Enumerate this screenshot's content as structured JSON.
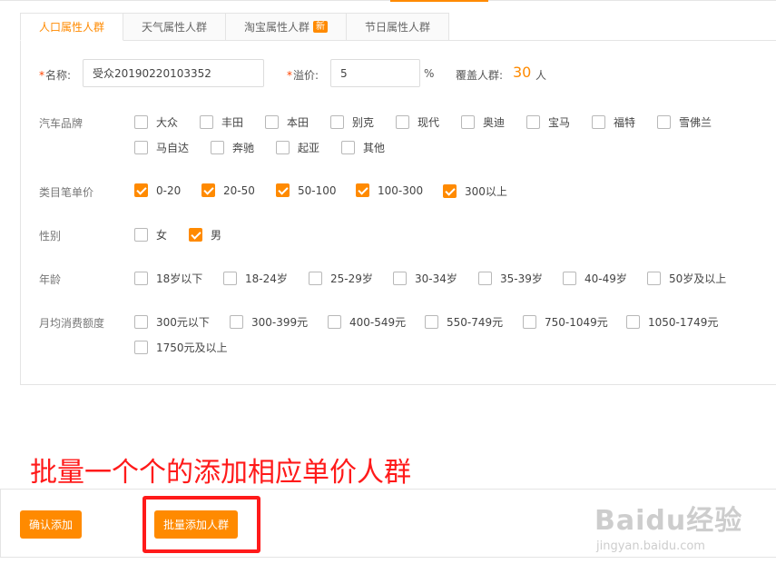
{
  "tabs": [
    {
      "label": "人口属性人群",
      "active": true
    },
    {
      "label": "天气属性人群",
      "active": false
    },
    {
      "label": "淘宝属性人群",
      "active": false,
      "badge": "新"
    },
    {
      "label": "节日属性人群",
      "active": false
    }
  ],
  "form": {
    "name_required": "*",
    "name_label": "名称:",
    "name_value": "受众20190220103352",
    "premium_required": "*",
    "premium_label": "溢价:",
    "premium_value": "5",
    "premium_unit": "%",
    "coverage_label": "覆盖人群:",
    "coverage_value": "30",
    "coverage_unit": "人"
  },
  "groups": {
    "car_brand": {
      "label": "汽车品牌",
      "options": [
        {
          "label": "大众",
          "checked": false
        },
        {
          "label": "丰田",
          "checked": false
        },
        {
          "label": "本田",
          "checked": false
        },
        {
          "label": "别克",
          "checked": false
        },
        {
          "label": "现代",
          "checked": false
        },
        {
          "label": "奥迪",
          "checked": false
        },
        {
          "label": "宝马",
          "checked": false
        },
        {
          "label": "福特",
          "checked": false
        },
        {
          "label": "雪佛兰",
          "checked": false
        },
        {
          "label": "马自达",
          "checked": false
        },
        {
          "label": "奔驰",
          "checked": false
        },
        {
          "label": "起亚",
          "checked": false
        },
        {
          "label": "其他",
          "checked": false
        }
      ]
    },
    "unit_price": {
      "label": "类目笔单价",
      "options": [
        {
          "label": "0-20",
          "checked": true
        },
        {
          "label": "20-50",
          "checked": true
        },
        {
          "label": "50-100",
          "checked": true
        },
        {
          "label": "100-300",
          "checked": true
        },
        {
          "label": "300以上",
          "checked": true
        }
      ]
    },
    "gender": {
      "label": "性别",
      "options": [
        {
          "label": "女",
          "checked": false
        },
        {
          "label": "男",
          "checked": true
        }
      ]
    },
    "age": {
      "label": "年龄",
      "options": [
        {
          "label": "18岁以下",
          "checked": false
        },
        {
          "label": "18-24岁",
          "checked": false
        },
        {
          "label": "25-29岁",
          "checked": false
        },
        {
          "label": "30-34岁",
          "checked": false
        },
        {
          "label": "35-39岁",
          "checked": false
        },
        {
          "label": "40-49岁",
          "checked": false
        },
        {
          "label": "50岁及以上",
          "checked": false
        }
      ]
    },
    "monthly_spend": {
      "label": "月均消费额度",
      "options": [
        {
          "label": "300元以下",
          "checked": false
        },
        {
          "label": "300-399元",
          "checked": false
        },
        {
          "label": "400-549元",
          "checked": false
        },
        {
          "label": "550-749元",
          "checked": false
        },
        {
          "label": "750-1049元",
          "checked": false
        },
        {
          "label": "1050-1749元",
          "checked": false
        },
        {
          "label": "1750元及以上",
          "checked": false
        }
      ]
    }
  },
  "annotation": "批量一个个的添加相应单价人群",
  "buttons": {
    "confirm_add": "确认添加",
    "batch_add": "批量添加人群"
  },
  "watermark": {
    "main": "Baidu经验",
    "sub": "jingyan.baidu.com"
  },
  "colors": {
    "accent": "#ff8a00",
    "annotation": "#ff1a1a"
  }
}
